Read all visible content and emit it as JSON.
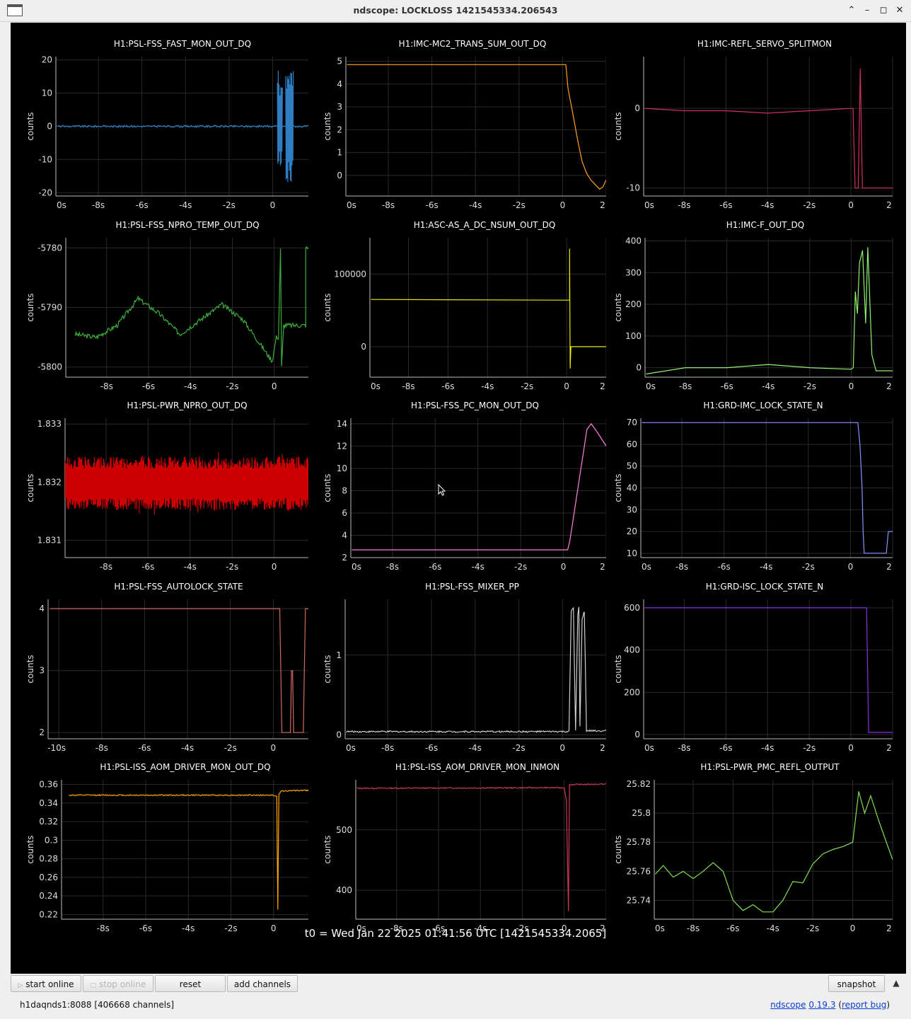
{
  "window": {
    "title": "ndscope: LOCKLOSS 1421545334.206543"
  },
  "t0_label": "t0 = Wed Jan 22 2025 01:41:56 UTC [1421545334.2065]",
  "toolbar": {
    "start_online": "start online",
    "stop_online": "stop online",
    "reset": "reset",
    "add_channels": "add channels",
    "snapshot": "snapshot"
  },
  "status": {
    "server": "h1daqnds1:8088  [406668 channels]",
    "app_name": "ndscope",
    "version": "0.19.3",
    "report_bug": "report bug"
  },
  "plots": [
    {
      "title": "H1:PSL-FSS_FAST_MON_OUT_DQ",
      "ylabel": "counts",
      "color": "#2f7ec3",
      "xticks": [
        "0s",
        "-8s",
        "-6s",
        "-4s",
        "-2s",
        "0",
        "2"
      ],
      "ylim": [
        -21,
        21
      ],
      "yticks": [
        "20",
        "10",
        "0",
        "-10",
        "-20"
      ],
      "yvals": [
        20,
        10,
        0,
        -10,
        -20
      ],
      "trace": {
        "type": "noise",
        "points": [
          [
            -9.9,
            0
          ],
          [
            0.05,
            0
          ],
          [
            0.15,
            0
          ],
          [
            0.9,
            0
          ],
          [
            2,
            0
          ]
        ],
        "noise": 0.3,
        "bursts": [
          [
            0.22,
            0.3,
            17
          ],
          [
            0.3,
            0.45,
            12
          ],
          [
            0.6,
            0.95,
            17
          ]
        ]
      }
    },
    {
      "title": "H1:IMC-MC2_TRANS_SUM_OUT_DQ",
      "ylabel": "counts",
      "color": "#ffa020",
      "xticks": [
        "0s",
        "-8s",
        "-6s",
        "-4s",
        "-2s",
        "0",
        "2"
      ],
      "ylim": [
        -0.9,
        5.2
      ],
      "yticks": [
        "5",
        "4",
        "3",
        "2",
        "1",
        "0"
      ],
      "yvals": [
        5,
        4,
        3,
        2,
        1,
        0
      ],
      "trace": {
        "type": "line",
        "points": [
          [
            -9.9,
            4.85
          ],
          [
            0.15,
            4.85
          ],
          [
            0.25,
            3.8
          ],
          [
            0.45,
            2.8
          ],
          [
            0.7,
            1.5
          ],
          [
            0.9,
            0.6
          ],
          [
            1.1,
            0.1
          ],
          [
            1.3,
            -0.2
          ],
          [
            1.5,
            -0.4
          ],
          [
            1.7,
            -0.6
          ],
          [
            1.85,
            -0.5
          ],
          [
            2,
            -0.2
          ]
        ]
      }
    },
    {
      "title": "H1:IMC-REFL_SERVO_SPLITMON",
      "ylabel": "counts",
      "color": "#d03060",
      "xticks": [
        "0s",
        "-8s",
        "-6s",
        "-4s",
        "-2s",
        "0",
        "2"
      ],
      "ylim": [
        -11,
        6.5
      ],
      "yticks": [
        "0",
        "-10"
      ],
      "yvals": [
        0,
        -10
      ],
      "trace": {
        "type": "line",
        "points": [
          [
            -9.9,
            0
          ],
          [
            -8,
            -0.3
          ],
          [
            -6,
            -0.3
          ],
          [
            -4,
            -0.6
          ],
          [
            -2,
            -0.3
          ],
          [
            0,
            0
          ],
          [
            0.1,
            0
          ],
          [
            0.2,
            -10
          ],
          [
            0.35,
            -10
          ],
          [
            0.45,
            5
          ],
          [
            0.55,
            -10
          ],
          [
            2,
            -10
          ]
        ]
      }
    },
    {
      "title": "H1:PSL-FSS_NPRO_TEMP_OUT_DQ",
      "ylabel": "counts",
      "color": "#3bae3b",
      "xticks": [
        "-8s",
        "-6s",
        "-4s",
        "-2s",
        "0",
        "2"
      ],
      "ylim": [
        -5801.7,
        -5778.3
      ],
      "yticks": [
        "-5780",
        "-5790",
        "-5800"
      ],
      "yvals": [
        -5780,
        -5790,
        -5800
      ],
      "trace": {
        "type": "noise",
        "noise": 0.4,
        "points": [
          [
            -9.5,
            -5794.5
          ],
          [
            -8.5,
            -5795
          ],
          [
            -7.5,
            -5793
          ],
          [
            -6.5,
            -5788.5
          ],
          [
            -5.5,
            -5791
          ],
          [
            -4.5,
            -5794.5
          ],
          [
            -3.5,
            -5792
          ],
          [
            -2.5,
            -5789.5
          ],
          [
            -1.5,
            -5792
          ],
          [
            -0.5,
            -5797
          ],
          [
            -0.1,
            -5799
          ],
          [
            0.1,
            -5795
          ],
          [
            0.2,
            -5795
          ],
          [
            0.3,
            -5780
          ],
          [
            0.35,
            -5800
          ],
          [
            0.45,
            -5793
          ],
          [
            0.6,
            -5793
          ],
          [
            1.5,
            -5793
          ],
          [
            1.5,
            -5780
          ],
          [
            2,
            -5780
          ]
        ]
      }
    },
    {
      "title": "H1:ASC-AS_A_DC_NSUM_OUT_DQ",
      "ylabel": "counts",
      "color": "#e8e800",
      "xticks": [
        "0s",
        "-8s",
        "-6s",
        "-4s",
        "-2s",
        "0",
        "2"
      ],
      "ylim": [
        -42000,
        150000
      ],
      "yticks": [
        "100000",
        "0"
      ],
      "yvals": [
        100000,
        0
      ],
      "trace": {
        "type": "line",
        "points": [
          [
            -9.9,
            65000
          ],
          [
            0.15,
            64000
          ],
          [
            0.15,
            135000
          ],
          [
            0.18,
            -30000
          ],
          [
            0.22,
            0
          ],
          [
            2,
            0
          ]
        ]
      }
    },
    {
      "title": "H1:IMC-F_OUT_DQ",
      "ylabel": "counts",
      "color": "#90f070",
      "xticks": [
        "0s",
        "-8s",
        "-6s",
        "-4s",
        "-2s",
        "0",
        "2"
      ],
      "ylim": [
        -30,
        410
      ],
      "yticks": [
        "400",
        "300",
        "200",
        "100",
        "0"
      ],
      "yvals": [
        400,
        300,
        200,
        100,
        0
      ],
      "trace": {
        "type": "line",
        "points": [
          [
            -9.9,
            -20
          ],
          [
            -8,
            0
          ],
          [
            -6,
            0
          ],
          [
            -4,
            10
          ],
          [
            -2,
            0
          ],
          [
            0,
            -5
          ],
          [
            0.1,
            0
          ],
          [
            0.2,
            240
          ],
          [
            0.3,
            170
          ],
          [
            0.4,
            330
          ],
          [
            0.55,
            370
          ],
          [
            0.7,
            140
          ],
          [
            0.8,
            380
          ],
          [
            1,
            40
          ],
          [
            1.2,
            -10
          ],
          [
            2,
            -10
          ]
        ]
      }
    },
    {
      "title": "H1:PSL-PWR_NPRO_OUT_DQ",
      "ylabel": "counts",
      "color": "#cc0000",
      "xticks": [
        "-8s",
        "-6s",
        "-4s",
        "-2s",
        "0",
        "2"
      ],
      "ylim": [
        1.8307,
        1.8331
      ],
      "yticks": [
        "1.833",
        "1.832",
        "1.831"
      ],
      "yvals": [
        1.833,
        1.832,
        1.831
      ],
      "trace": {
        "type": "band",
        "center": 1.83198,
        "half": 0.00046,
        "spike": 0.00062
      }
    },
    {
      "title": "H1:PSL-FSS_PC_MON_OUT_DQ",
      "ylabel": "counts",
      "color": "#ff80e0",
      "xticks": [
        "0s",
        "-8s",
        "-6s",
        "-4s",
        "-2s",
        "0",
        "2"
      ],
      "ylim": [
        2,
        14.5
      ],
      "yticks": [
        "14",
        "12",
        "10",
        "8",
        "6",
        "4",
        "2"
      ],
      "yvals": [
        14,
        12,
        10,
        8,
        6,
        4,
        2
      ],
      "trace": {
        "type": "line",
        "points": [
          [
            -9.9,
            2.7
          ],
          [
            0.2,
            2.7
          ],
          [
            0.3,
            3.5
          ],
          [
            0.5,
            6
          ],
          [
            0.7,
            8.5
          ],
          [
            0.9,
            11
          ],
          [
            1.1,
            13.5
          ],
          [
            1.3,
            14
          ],
          [
            1.6,
            13.2
          ],
          [
            2,
            12
          ]
        ]
      }
    },
    {
      "title": "H1:GRD-IMC_LOCK_STATE_N",
      "ylabel": "counts",
      "color": "#9090ff",
      "xticks": [
        "0s",
        "-8s",
        "-6s",
        "-4s",
        "-2s",
        "0",
        "2"
      ],
      "ylim": [
        8,
        72
      ],
      "yticks": [
        "70",
        "60",
        "50",
        "40",
        "30",
        "20",
        "10"
      ],
      "yvals": [
        70,
        60,
        50,
        40,
        30,
        20,
        10
      ],
      "trace": {
        "type": "line",
        "points": [
          [
            -9.9,
            70
          ],
          [
            0.35,
            70
          ],
          [
            0.45,
            60
          ],
          [
            0.55,
            40
          ],
          [
            0.6,
            20
          ],
          [
            0.65,
            10
          ],
          [
            1.7,
            10
          ],
          [
            1.8,
            20
          ],
          [
            2,
            20
          ]
        ]
      }
    },
    {
      "title": "H1:PSL-FSS_AUTOLOCK_STATE",
      "ylabel": "counts",
      "color": "#d06a5c",
      "xticks": [
        "-10s",
        "-8s",
        "-6s",
        "-4s",
        "-2s",
        "0",
        "2"
      ],
      "ylim": [
        1.9,
        4.15
      ],
      "yticks": [
        "4",
        "3",
        "2"
      ],
      "yvals": [
        4,
        3,
        2
      ],
      "trace": {
        "type": "line",
        "points": [
          [
            -10.4,
            4
          ],
          [
            0.3,
            4
          ],
          [
            0.4,
            2
          ],
          [
            0.8,
            2
          ],
          [
            0.85,
            3
          ],
          [
            0.9,
            3
          ],
          [
            0.95,
            2
          ],
          [
            1.4,
            2
          ],
          [
            1.5,
            4
          ],
          [
            2,
            4
          ]
        ]
      }
    },
    {
      "title": "H1:PSL-FSS_MIXER_PP",
      "ylabel": "counts",
      "color": "#cfcfcf",
      "xticks": [
        "0s",
        "-8s",
        "-6s",
        "-4s",
        "-2s",
        "0",
        "2"
      ],
      "ylim": [
        -0.05,
        1.7
      ],
      "yticks": [
        "1",
        "0"
      ],
      "yvals": [
        1,
        0
      ],
      "trace": {
        "type": "noise",
        "noise": 0.01,
        "points": [
          [
            -9.9,
            0.04
          ],
          [
            0.3,
            0.04
          ],
          [
            0.4,
            1.55
          ],
          [
            0.5,
            1.6
          ],
          [
            0.6,
            0.05
          ],
          [
            0.7,
            1.5
          ],
          [
            0.75,
            1.6
          ],
          [
            0.8,
            0.1
          ],
          [
            0.9,
            1.45
          ],
          [
            1,
            1.55
          ],
          [
            1.1,
            0.05
          ],
          [
            2,
            0.05
          ]
        ]
      }
    },
    {
      "title": "H1:GRD-ISC_LOCK_STATE_N",
      "ylabel": "counts",
      "color": "#8a30e0",
      "xticks": [
        "0s",
        "-8s",
        "-6s",
        "-4s",
        "-2s",
        "0",
        "2"
      ],
      "ylim": [
        -20,
        640
      ],
      "yticks": [
        "600",
        "400",
        "200",
        "0"
      ],
      "yvals": [
        600,
        400,
        200,
        0
      ],
      "trace": {
        "type": "line",
        "points": [
          [
            -9.9,
            600
          ],
          [
            0.75,
            600
          ],
          [
            0.85,
            10
          ],
          [
            2,
            10
          ]
        ]
      }
    },
    {
      "title": "H1:PSL-ISS_AOM_DRIVER_MON_OUT_DQ",
      "ylabel": "counts",
      "color": "#ffa500",
      "xticks": [
        "-8s",
        "-6s",
        "-4s",
        "-2s",
        "0",
        "2"
      ],
      "ylim": [
        0.215,
        0.365
      ],
      "yticks": [
        "0.36",
        "0.34",
        "0.32",
        "0.3",
        "0.28",
        "0.26",
        "0.24",
        "0.22"
      ],
      "yvals": [
        0.36,
        0.34,
        0.32,
        0.3,
        0.28,
        0.26,
        0.24,
        0.22
      ],
      "trace": {
        "type": "noise",
        "noise": 0.0006,
        "points": [
          [
            -9.6,
            0.3485
          ],
          [
            0,
            0.3485
          ],
          [
            0.15,
            0.347
          ],
          [
            0.2,
            0.225
          ],
          [
            0.25,
            0.349
          ],
          [
            0.35,
            0.353
          ],
          [
            2,
            0.354
          ]
        ]
      }
    },
    {
      "title": "H1:PSL-ISS_AOM_DRIVER_MON_INMON",
      "ylabel": "counts",
      "color": "#c8385a",
      "xticks": [
        "0s",
        "-8s",
        "-6s",
        "-4s",
        "-2s",
        "0",
        "2"
      ],
      "ylim": [
        352,
        583
      ],
      "yticks": [
        "500",
        "400"
      ],
      "yvals": [
        500,
        400
      ],
      "trace": {
        "type": "noise",
        "noise": 1,
        "points": [
          [
            -9.9,
            569
          ],
          [
            0,
            570
          ],
          [
            0.1,
            550
          ],
          [
            0.2,
            365
          ],
          [
            0.25,
            575
          ],
          [
            2,
            576
          ]
        ]
      }
    },
    {
      "title": "H1:PSL-PWR_PMC_REFL_OUTPUT",
      "ylabel": "counts",
      "color": "#80e050",
      "xticks": [
        "0s",
        "-8s",
        "-6s",
        "-4s",
        "-2s",
        "0",
        "2"
      ],
      "ylim": [
        25.727,
        25.823
      ],
      "yticks": [
        "25.82",
        "25.8",
        "25.78",
        "25.76",
        "25.74"
      ],
      "yvals": [
        25.82,
        25.8,
        25.78,
        25.76,
        25.74
      ],
      "trace": {
        "type": "line",
        "points": [
          [
            -9.9,
            25.758
          ],
          [
            -9.5,
            25.764
          ],
          [
            -9,
            25.756
          ],
          [
            -8.5,
            25.76
          ],
          [
            -8,
            25.755
          ],
          [
            -7.5,
            25.76
          ],
          [
            -7,
            25.766
          ],
          [
            -6.5,
            25.76
          ],
          [
            -6,
            25.74
          ],
          [
            -5.5,
            25.733
          ],
          [
            -5,
            25.737
          ],
          [
            -4.5,
            25.732
          ],
          [
            -4,
            25.732
          ],
          [
            -3.5,
            25.74
          ],
          [
            -3,
            25.753
          ],
          [
            -2.5,
            25.752
          ],
          [
            -2,
            25.765
          ],
          [
            -1.5,
            25.772
          ],
          [
            -1,
            25.775
          ],
          [
            -0.5,
            25.777
          ],
          [
            0,
            25.78
          ],
          [
            0.3,
            25.815
          ],
          [
            0.6,
            25.8
          ],
          [
            0.9,
            25.812
          ],
          [
            1.3,
            25.795
          ],
          [
            2,
            25.768
          ]
        ]
      }
    }
  ]
}
